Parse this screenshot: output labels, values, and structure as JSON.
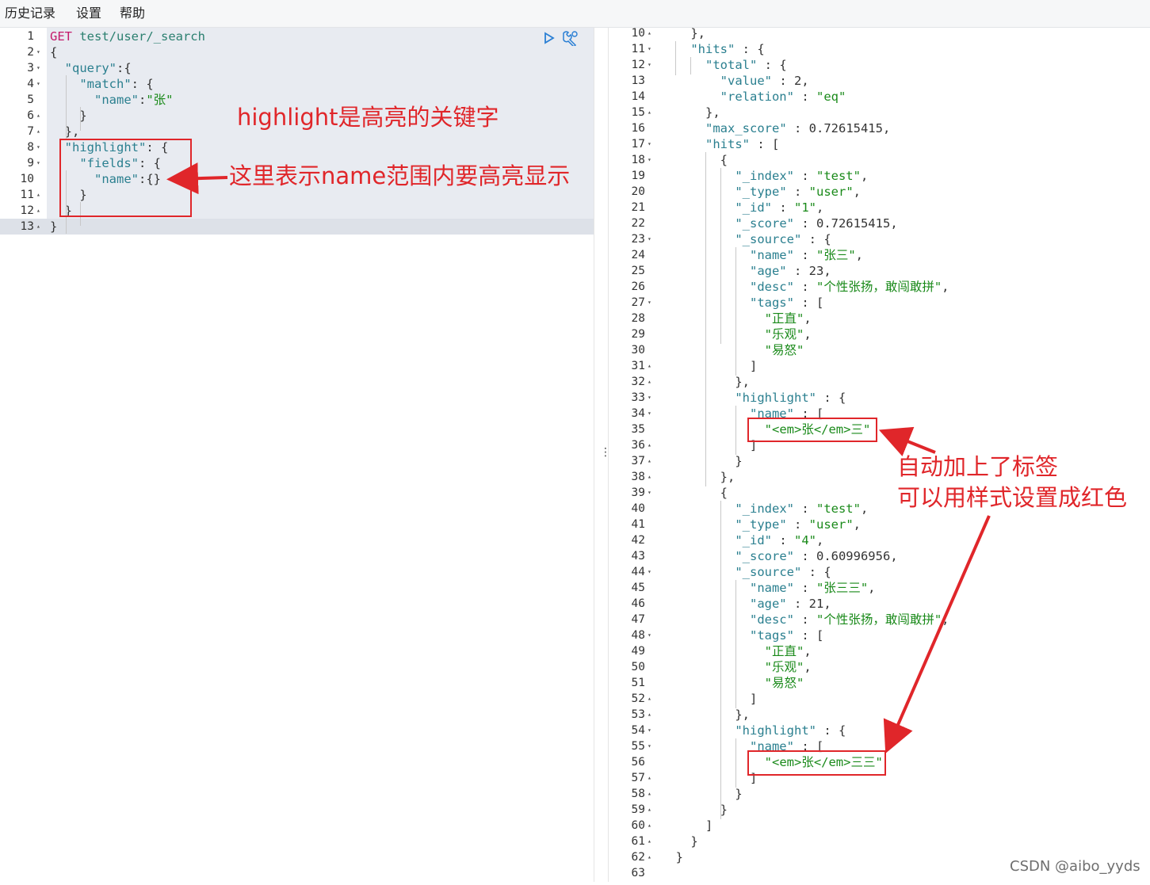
{
  "menu": {
    "items": [
      "历史记录",
      "设置",
      "帮助"
    ]
  },
  "request": {
    "lines": [
      [
        [
          "method",
          "GET"
        ],
        [
          "url",
          " test/user/_search"
        ]
      ],
      [
        [
          "p",
          "{"
        ]
      ],
      [
        [
          "p",
          "  "
        ],
        [
          "key",
          "\"query\""
        ],
        [
          "p",
          ":{"
        ]
      ],
      [
        [
          "p",
          "    "
        ],
        [
          "key",
          "\"match\""
        ],
        [
          "p",
          ": {"
        ]
      ],
      [
        [
          "p",
          "      "
        ],
        [
          "key",
          "\"name\""
        ],
        [
          "p",
          ":"
        ],
        [
          "str",
          "\"张\""
        ]
      ],
      [
        [
          "p",
          "    }"
        ]
      ],
      [
        [
          "p",
          "  },"
        ]
      ],
      [
        [
          "p",
          "  "
        ],
        [
          "key",
          "\"highlight\""
        ],
        [
          "p",
          ": {"
        ]
      ],
      [
        [
          "p",
          "    "
        ],
        [
          "key",
          "\"fields\""
        ],
        [
          "p",
          ": {"
        ]
      ],
      [
        [
          "p",
          "      "
        ],
        [
          "key",
          "\"name\""
        ],
        [
          "p",
          ":{}"
        ]
      ],
      [
        [
          "p",
          "    }"
        ]
      ],
      [
        [
          "p",
          "  }"
        ]
      ],
      [
        [
          "p",
          "}"
        ]
      ]
    ],
    "line_numbers": [
      "1",
      "2",
      "3",
      "4",
      "5",
      "6",
      "7",
      "8",
      "9",
      "10",
      "11",
      "12",
      "13"
    ],
    "fold_marks": [
      "",
      "▾",
      "▾",
      "▾",
      "",
      "▴",
      "▴",
      "▾",
      "▾",
      "",
      "▴",
      "▴",
      "▴"
    ]
  },
  "response": {
    "line_numbers": [
      "10",
      "11",
      "12",
      "13",
      "14",
      "15",
      "16",
      "17",
      "18",
      "19",
      "20",
      "21",
      "22",
      "23",
      "24",
      "25",
      "26",
      "27",
      "28",
      "29",
      "30",
      "31",
      "32",
      "33",
      "34",
      "35",
      "36",
      "37",
      "38",
      "39",
      "40",
      "41",
      "42",
      "43",
      "44",
      "45",
      "46",
      "47",
      "48",
      "49",
      "50",
      "51",
      "52",
      "53",
      "54",
      "55",
      "56",
      "57",
      "58",
      "59",
      "60",
      "61",
      "62",
      "63"
    ],
    "fold_marks": [
      "▴",
      "▾",
      "▾",
      "",
      "",
      "▴",
      "",
      "▾",
      "▾",
      "",
      "",
      "",
      "",
      "▾",
      "",
      "",
      "",
      "▾",
      "",
      "",
      "",
      "▴",
      "▴",
      "▾",
      "▾",
      "",
      "▴",
      "▴",
      "▴",
      "▾",
      "",
      "",
      "",
      "",
      "▾",
      "",
      "",
      "",
      "▾",
      "",
      "",
      "",
      "▴",
      "▴",
      "▾",
      "▾",
      "",
      "▴",
      "▴",
      "▴",
      "▴",
      "▴",
      "▴",
      ""
    ],
    "lines": [
      [
        [
          "p",
          "    },"
        ]
      ],
      [
        [
          "p",
          "    "
        ],
        [
          "key",
          "\"hits\""
        ],
        [
          "p",
          " : {"
        ]
      ],
      [
        [
          "p",
          "      "
        ],
        [
          "key",
          "\"total\""
        ],
        [
          "p",
          " : {"
        ]
      ],
      [
        [
          "p",
          "        "
        ],
        [
          "key",
          "\"value\""
        ],
        [
          "p",
          " : "
        ],
        [
          "num",
          "2"
        ],
        [
          "p",
          ","
        ]
      ],
      [
        [
          "p",
          "        "
        ],
        [
          "key",
          "\"relation\""
        ],
        [
          "p",
          " : "
        ],
        [
          "str",
          "\"eq\""
        ]
      ],
      [
        [
          "p",
          "      },"
        ]
      ],
      [
        [
          "p",
          "      "
        ],
        [
          "key",
          "\"max_score\""
        ],
        [
          "p",
          " : "
        ],
        [
          "num",
          "0.72615415"
        ],
        [
          "p",
          ","
        ]
      ],
      [
        [
          "p",
          "      "
        ],
        [
          "key",
          "\"hits\""
        ],
        [
          "p",
          " : ["
        ]
      ],
      [
        [
          "p",
          "        {"
        ]
      ],
      [
        [
          "p",
          "          "
        ],
        [
          "key",
          "\"_index\""
        ],
        [
          "p",
          " : "
        ],
        [
          "str",
          "\"test\""
        ],
        [
          "p",
          ","
        ]
      ],
      [
        [
          "p",
          "          "
        ],
        [
          "key",
          "\"_type\""
        ],
        [
          "p",
          " : "
        ],
        [
          "str",
          "\"user\""
        ],
        [
          "p",
          ","
        ]
      ],
      [
        [
          "p",
          "          "
        ],
        [
          "key",
          "\"_id\""
        ],
        [
          "p",
          " : "
        ],
        [
          "str",
          "\"1\""
        ],
        [
          "p",
          ","
        ]
      ],
      [
        [
          "p",
          "          "
        ],
        [
          "key",
          "\"_score\""
        ],
        [
          "p",
          " : "
        ],
        [
          "num",
          "0.72615415"
        ],
        [
          "p",
          ","
        ]
      ],
      [
        [
          "p",
          "          "
        ],
        [
          "key",
          "\"_source\""
        ],
        [
          "p",
          " : {"
        ]
      ],
      [
        [
          "p",
          "            "
        ],
        [
          "key",
          "\"name\""
        ],
        [
          "p",
          " : "
        ],
        [
          "str",
          "\"张三\""
        ],
        [
          "p",
          ","
        ]
      ],
      [
        [
          "p",
          "            "
        ],
        [
          "key",
          "\"age\""
        ],
        [
          "p",
          " : "
        ],
        [
          "num",
          "23"
        ],
        [
          "p",
          ","
        ]
      ],
      [
        [
          "p",
          "            "
        ],
        [
          "key",
          "\"desc\""
        ],
        [
          "p",
          " : "
        ],
        [
          "str",
          "\"个性张扬，敢闯敢拼\""
        ],
        [
          "p",
          ","
        ]
      ],
      [
        [
          "p",
          "            "
        ],
        [
          "key",
          "\"tags\""
        ],
        [
          "p",
          " : ["
        ]
      ],
      [
        [
          "p",
          "              "
        ],
        [
          "str",
          "\"正直\""
        ],
        [
          "p",
          ","
        ]
      ],
      [
        [
          "p",
          "              "
        ],
        [
          "str",
          "\"乐观\""
        ],
        [
          "p",
          ","
        ]
      ],
      [
        [
          "p",
          "              "
        ],
        [
          "str",
          "\"易怒\""
        ]
      ],
      [
        [
          "p",
          "            ]"
        ]
      ],
      [
        [
          "p",
          "          },"
        ]
      ],
      [
        [
          "p",
          "          "
        ],
        [
          "key",
          "\"highlight\""
        ],
        [
          "p",
          " : {"
        ]
      ],
      [
        [
          "p",
          "            "
        ],
        [
          "key",
          "\"name\""
        ],
        [
          "p",
          " : ["
        ]
      ],
      [
        [
          "p",
          "              "
        ],
        [
          "str",
          "\"<em>张</em>三\""
        ]
      ],
      [
        [
          "p",
          "            ]"
        ]
      ],
      [
        [
          "p",
          "          }"
        ]
      ],
      [
        [
          "p",
          "        },"
        ]
      ],
      [
        [
          "p",
          "        {"
        ]
      ],
      [
        [
          "p",
          "          "
        ],
        [
          "key",
          "\"_index\""
        ],
        [
          "p",
          " : "
        ],
        [
          "str",
          "\"test\""
        ],
        [
          "p",
          ","
        ]
      ],
      [
        [
          "p",
          "          "
        ],
        [
          "key",
          "\"_type\""
        ],
        [
          "p",
          " : "
        ],
        [
          "str",
          "\"user\""
        ],
        [
          "p",
          ","
        ]
      ],
      [
        [
          "p",
          "          "
        ],
        [
          "key",
          "\"_id\""
        ],
        [
          "p",
          " : "
        ],
        [
          "str",
          "\"4\""
        ],
        [
          "p",
          ","
        ]
      ],
      [
        [
          "p",
          "          "
        ],
        [
          "key",
          "\"_score\""
        ],
        [
          "p",
          " : "
        ],
        [
          "num",
          "0.60996956"
        ],
        [
          "p",
          ","
        ]
      ],
      [
        [
          "p",
          "          "
        ],
        [
          "key",
          "\"_source\""
        ],
        [
          "p",
          " : {"
        ]
      ],
      [
        [
          "p",
          "            "
        ],
        [
          "key",
          "\"name\""
        ],
        [
          "p",
          " : "
        ],
        [
          "str",
          "\"张三三\""
        ],
        [
          "p",
          ","
        ]
      ],
      [
        [
          "p",
          "            "
        ],
        [
          "key",
          "\"age\""
        ],
        [
          "p",
          " : "
        ],
        [
          "num",
          "21"
        ],
        [
          "p",
          ","
        ]
      ],
      [
        [
          "p",
          "            "
        ],
        [
          "key",
          "\"desc\""
        ],
        [
          "p",
          " : "
        ],
        [
          "str",
          "\"个性张扬，敢闯敢拼\""
        ],
        [
          "p",
          ","
        ]
      ],
      [
        [
          "p",
          "            "
        ],
        [
          "key",
          "\"tags\""
        ],
        [
          "p",
          " : ["
        ]
      ],
      [
        [
          "p",
          "              "
        ],
        [
          "str",
          "\"正直\""
        ],
        [
          "p",
          ","
        ]
      ],
      [
        [
          "p",
          "              "
        ],
        [
          "str",
          "\"乐观\""
        ],
        [
          "p",
          ","
        ]
      ],
      [
        [
          "p",
          "              "
        ],
        [
          "str",
          "\"易怒\""
        ]
      ],
      [
        [
          "p",
          "            ]"
        ]
      ],
      [
        [
          "p",
          "          },"
        ]
      ],
      [
        [
          "p",
          "          "
        ],
        [
          "key",
          "\"highlight\""
        ],
        [
          "p",
          " : {"
        ]
      ],
      [
        [
          "p",
          "            "
        ],
        [
          "key",
          "\"name\""
        ],
        [
          "p",
          " : ["
        ]
      ],
      [
        [
          "p",
          "              "
        ],
        [
          "str",
          "\"<em>张</em>三三\""
        ]
      ],
      [
        [
          "p",
          "            ]"
        ]
      ],
      [
        [
          "p",
          "          }"
        ]
      ],
      [
        [
          "p",
          "        }"
        ]
      ],
      [
        [
          "p",
          "      ]"
        ]
      ],
      [
        [
          "p",
          "    }"
        ]
      ],
      [
        [
          "p",
          "  }"
        ]
      ],
      [
        [
          "p",
          ""
        ]
      ]
    ]
  },
  "annotations": {
    "left_title": "highlight是高亮的关键字",
    "left_arrow_text": "这里表示name范围内要高亮显示",
    "right_line1": "自动加上了标签",
    "right_line2": "可以用样式设置成红色"
  },
  "toolbar": {
    "run_icon": "play-icon",
    "settings_icon": "wrench-icon"
  },
  "watermark": "CSDN @aibo_yyds",
  "colors": {
    "annotation": "#e0262a",
    "key": "#2a7f8f",
    "string": "#1a8a1a",
    "method": "#c41a6b"
  }
}
